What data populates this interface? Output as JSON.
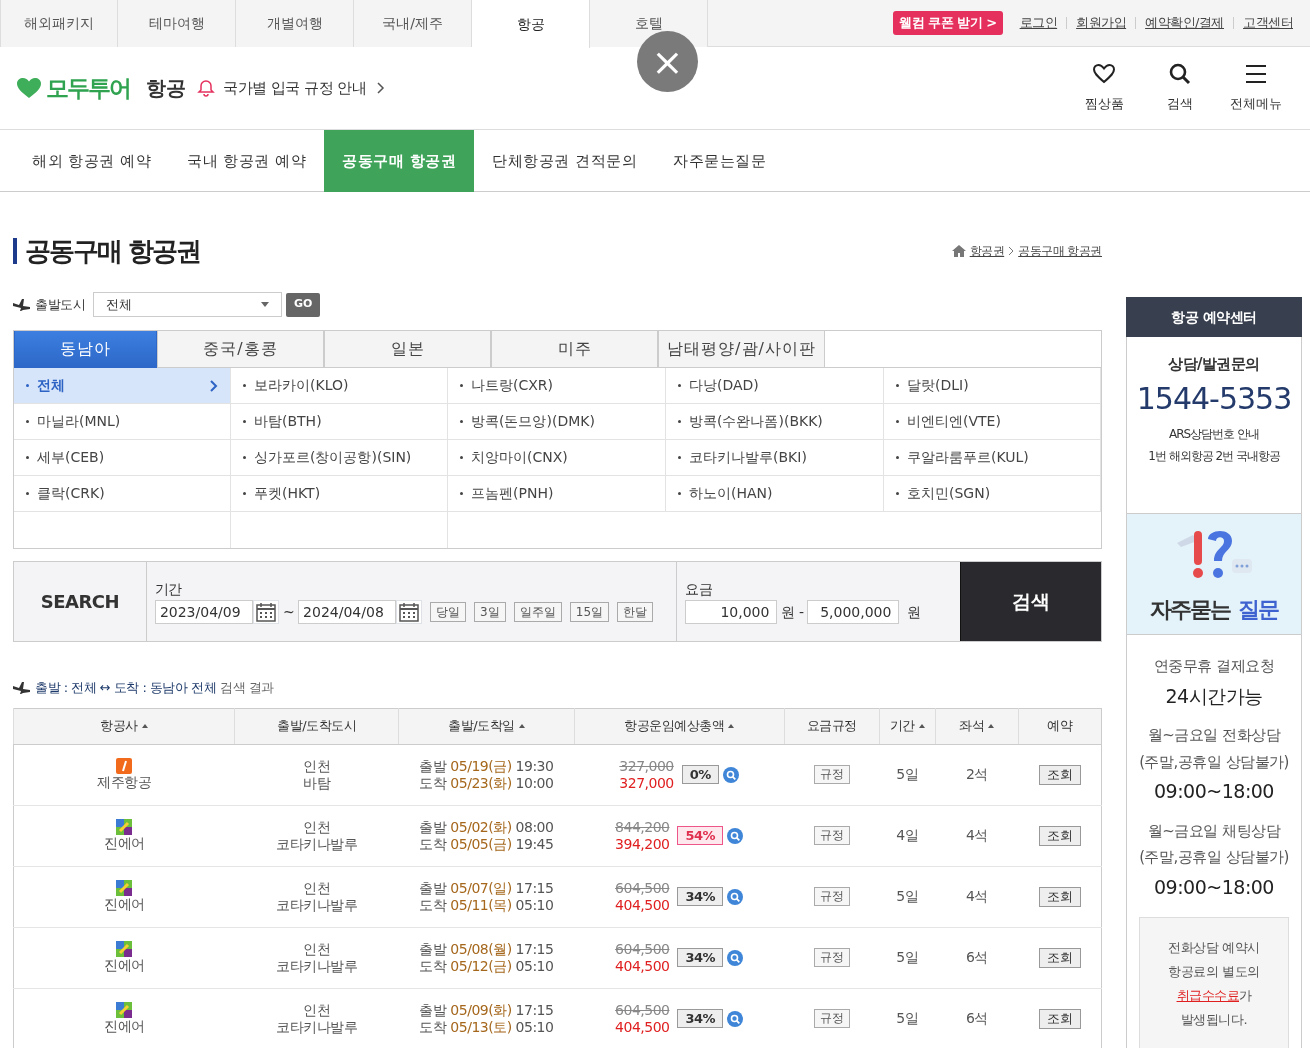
{
  "top_tabs": [
    {
      "label": "해외패키지",
      "selected": false
    },
    {
      "label": "테마여행",
      "selected": false
    },
    {
      "label": "개별여행",
      "selected": false
    },
    {
      "label": "국내/제주",
      "selected": false
    },
    {
      "label": "항공",
      "selected": true
    },
    {
      "label": "호텔",
      "selected": false
    }
  ],
  "coupon": "웰컴 쿠폰 받기 >",
  "top_links": [
    "로그인",
    "회원가입",
    "예약확인/결제",
    "고객센터"
  ],
  "logo": "모두투어",
  "section": "항공",
  "notice": "국가별 입국 규정 안내",
  "header_icons": [
    {
      "kind": "heart",
      "label": "찜상품"
    },
    {
      "kind": "search",
      "label": "검색"
    },
    {
      "kind": "menu",
      "label": "전체메뉴"
    }
  ],
  "main_nav": [
    {
      "label": "해외 항공권 예약",
      "selected": false
    },
    {
      "label": "국내 항공권 예약",
      "selected": false
    },
    {
      "label": "공동구매 항공권",
      "selected": true
    },
    {
      "label": "단체항공권 견적문의",
      "selected": false
    },
    {
      "label": "자주묻는질문",
      "selected": false
    }
  ],
  "page_title": "공동구매 항공권",
  "breadcrumb": [
    "항공권",
    "공동구매 항공권"
  ],
  "departure": {
    "label": "출발도시",
    "value": "전체",
    "button": "GO"
  },
  "region_tabs": [
    {
      "label": "동남아",
      "selected": true
    },
    {
      "label": "중국/홍콩",
      "selected": false
    },
    {
      "label": "일본",
      "selected": false
    },
    {
      "label": "미주",
      "selected": false
    },
    {
      "label": "남태평양/괌/사이판",
      "selected": false
    }
  ],
  "cities": [
    {
      "label": "전체",
      "selected": true
    },
    {
      "label": "보라카이(KLO)",
      "selected": false
    },
    {
      "label": "나트랑(CXR)",
      "selected": false
    },
    {
      "label": "다낭(DAD)",
      "selected": false
    },
    {
      "label": "달랏(DLI)",
      "selected": false
    },
    {
      "label": "마닐라(MNL)",
      "selected": false
    },
    {
      "label": "바탐(BTH)",
      "selected": false
    },
    {
      "label": "방콕(돈므앙)(DMK)",
      "selected": false
    },
    {
      "label": "방콕(수완나폼)(BKK)",
      "selected": false
    },
    {
      "label": "비엔티엔(VTE)",
      "selected": false
    },
    {
      "label": "세부(CEB)",
      "selected": false
    },
    {
      "label": "싱가포르(창이공항)(SIN)",
      "selected": false
    },
    {
      "label": "치앙마이(CNX)",
      "selected": false
    },
    {
      "label": "코타키나발루(BKI)",
      "selected": false
    },
    {
      "label": "쿠알라룸푸르(KUL)",
      "selected": false
    },
    {
      "label": "클락(CRK)",
      "selected": false
    },
    {
      "label": "푸켓(HKT)",
      "selected": false
    },
    {
      "label": "프놈펜(PNH)",
      "selected": false
    },
    {
      "label": "하노이(HAN)",
      "selected": false
    },
    {
      "label": "호치민(SGN)",
      "selected": false
    }
  ],
  "search": {
    "label": "SEARCH",
    "period_label": "기간",
    "date_from": "2023/04/09",
    "separator": "~",
    "date_to": "2024/04/08",
    "quick": [
      "당일",
      "3일",
      "일주일",
      "15일",
      "한달"
    ],
    "fare_label": "요금",
    "fare_min": "10,000",
    "fare_max": "5,000,000",
    "unit_min": "원",
    "unit_max": "원",
    "dash": "-",
    "button": "검색"
  },
  "result_summary": "출발 : 전체 ↔ 도착 : 동남아 전체",
  "result_suffix": "검색 결과",
  "columns": [
    {
      "label": "항공사",
      "sortable": true
    },
    {
      "label": "출발/도착도시",
      "sortable": false
    },
    {
      "label": "출발/도착일",
      "sortable": true
    },
    {
      "label": "항공운임예상총액",
      "sortable": true
    },
    {
      "label": "요금규정",
      "sortable": false
    },
    {
      "label": "기간",
      "sortable": true
    },
    {
      "label": "좌석",
      "sortable": true
    },
    {
      "label": "예약",
      "sortable": false
    }
  ],
  "rows": [
    {
      "airline": "제주항공",
      "kind": "jeju",
      "from": "인천",
      "to": "바탐",
      "dep_label": "출발",
      "dep_date": "05/19(금)",
      "dep_time": "19:30",
      "arr_label": "도착",
      "arr_date": "05/23(화)",
      "arr_time": "10:00",
      "list_price": "327,000",
      "price": "327,000",
      "discount": "0%",
      "hot": false,
      "rule": "규정",
      "duration": "5일",
      "seats": "2석",
      "action": "조회"
    },
    {
      "airline": "진에어",
      "kind": "jinair",
      "from": "인천",
      "to": "코타키나발루",
      "dep_label": "출발",
      "dep_date": "05/02(화)",
      "dep_time": "08:00",
      "arr_label": "도착",
      "arr_date": "05/05(금)",
      "arr_time": "19:45",
      "list_price": "844,200",
      "price": "394,200",
      "discount": "54%",
      "hot": true,
      "rule": "규정",
      "duration": "4일",
      "seats": "4석",
      "action": "조회"
    },
    {
      "airline": "진에어",
      "kind": "jinair",
      "from": "인천",
      "to": "코타키나발루",
      "dep_label": "출발",
      "dep_date": "05/07(일)",
      "dep_time": "17:15",
      "arr_label": "도착",
      "arr_date": "05/11(목)",
      "arr_time": "05:10",
      "list_price": "604,500",
      "price": "404,500",
      "discount": "34%",
      "hot": false,
      "rule": "규정",
      "duration": "5일",
      "seats": "4석",
      "action": "조회"
    },
    {
      "airline": "진에어",
      "kind": "jinair",
      "from": "인천",
      "to": "코타키나발루",
      "dep_label": "출발",
      "dep_date": "05/08(월)",
      "dep_time": "17:15",
      "arr_label": "도착",
      "arr_date": "05/12(금)",
      "arr_time": "05:10",
      "list_price": "604,500",
      "price": "404,500",
      "discount": "34%",
      "hot": false,
      "rule": "규정",
      "duration": "5일",
      "seats": "6석",
      "action": "조회"
    },
    {
      "airline": "진에어",
      "kind": "jinair",
      "from": "인천",
      "to": "코타키나발루",
      "dep_label": "출발",
      "dep_date": "05/09(화)",
      "dep_time": "17:15",
      "arr_label": "도착",
      "arr_date": "05/13(토)",
      "arr_time": "05:10",
      "list_price": "604,500",
      "price": "404,500",
      "discount": "34%",
      "hot": false,
      "rule": "규정",
      "duration": "5일",
      "seats": "6석",
      "action": "조회"
    }
  ],
  "sidebar": {
    "title": "항공 예약센터",
    "consult": "상담/발권문의",
    "phone": "1544-5353",
    "ars": [
      "ARS상담번호 안내",
      "1번 해외항공 2번 국내항공"
    ],
    "faq_text": "자주묻는",
    "faq_highlight": "질문",
    "info": [
      {
        "kind": "small",
        "text": "연중무휴 결제요청"
      },
      {
        "kind": "large",
        "text": "24시간가능"
      },
      {
        "kind": "small",
        "text": "월~금요일 전화상담"
      },
      {
        "kind": "small",
        "text": "(주말,공휴일 상담불가)"
      },
      {
        "kind": "large",
        "text": "09:00~18:00"
      },
      {
        "kind": "small",
        "text": "월~금요일 채팅상담"
      },
      {
        "kind": "small",
        "text": "(주말,공휴일 상담불가)"
      },
      {
        "kind": "large",
        "text": "09:00~18:00"
      }
    ],
    "note_lines": [
      "전화상담 예약시",
      "항공료의 별도의"
    ],
    "note_link": "취급수수료",
    "note_after": "가",
    "note_last": "발생됩니다."
  },
  "overlay_close": "×"
}
